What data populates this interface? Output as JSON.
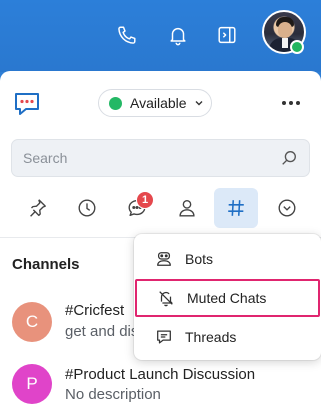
{
  "header": {
    "icons": [
      "phone-icon",
      "bell-icon",
      "sidebar-toggle-icon"
    ],
    "presence_color": "#22b55f"
  },
  "status": {
    "label": "Available",
    "color": "#24b865"
  },
  "search": {
    "placeholder": "Search"
  },
  "tabs": [
    {
      "name": "pinned",
      "icon": "pin-icon"
    },
    {
      "name": "recent",
      "icon": "clock-icon"
    },
    {
      "name": "chats",
      "icon": "chat-bubble-icon",
      "badge": "1"
    },
    {
      "name": "contacts",
      "icon": "person-icon"
    },
    {
      "name": "channels",
      "icon": "hash-icon",
      "active": true
    },
    {
      "name": "more",
      "icon": "chevron-down-circle-icon"
    }
  ],
  "channels": {
    "title": "Channels",
    "items": [
      {
        "initial": "C",
        "name": "#Cricfest",
        "subtitle": "get and dis",
        "color": "#e8927c"
      },
      {
        "initial": "P",
        "name": "#Product Launch Discussion",
        "subtitle": "No description",
        "color": "#e044c9"
      }
    ]
  },
  "menu": {
    "items": [
      {
        "label": "Bots",
        "icon": "bot-icon"
      },
      {
        "label": "Muted Chats",
        "icon": "muted-bell-icon",
        "highlighted": true
      },
      {
        "label": "Threads",
        "icon": "thread-icon"
      }
    ],
    "highlight_color": "#e0256f"
  }
}
